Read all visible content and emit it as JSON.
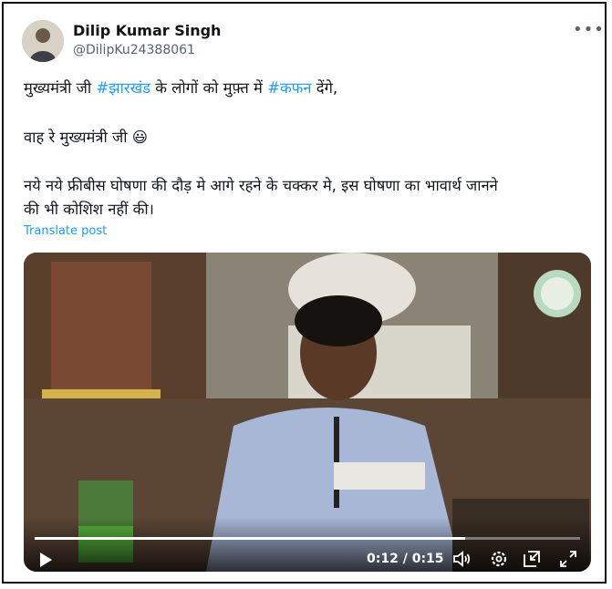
{
  "author": {
    "name": "Dilip Kumar Singh",
    "handle": "@DilipKu24388061"
  },
  "tweet": {
    "line1": {
      "pre": "मुख्यमंत्री जी ",
      "tag1": "#झारखंड",
      "mid": " के लोगों को मुफ़्त में ",
      "tag2": "#कफन",
      "post": " देंगे,"
    },
    "line2": "वाह रे मुख्यमंत्री जी 😃",
    "line3": "नये नये फ्रीबीस घोषणा की दौड़ मे आगे रहने के चक्कर मे, इस घोषणा का भावार्थ जानने",
    "line4": "की भी कोशिश नहीं की।",
    "translate": "Translate post"
  },
  "video": {
    "current_time": "0:12",
    "separator": " / ",
    "duration": "0:15",
    "progress_fraction": 0.79
  },
  "icons": {
    "more": "more-icon",
    "play": "play-icon",
    "volume": "volume-icon",
    "settings": "settings-icon",
    "pip": "pip-icon",
    "fullscreen": "fullscreen-icon"
  }
}
